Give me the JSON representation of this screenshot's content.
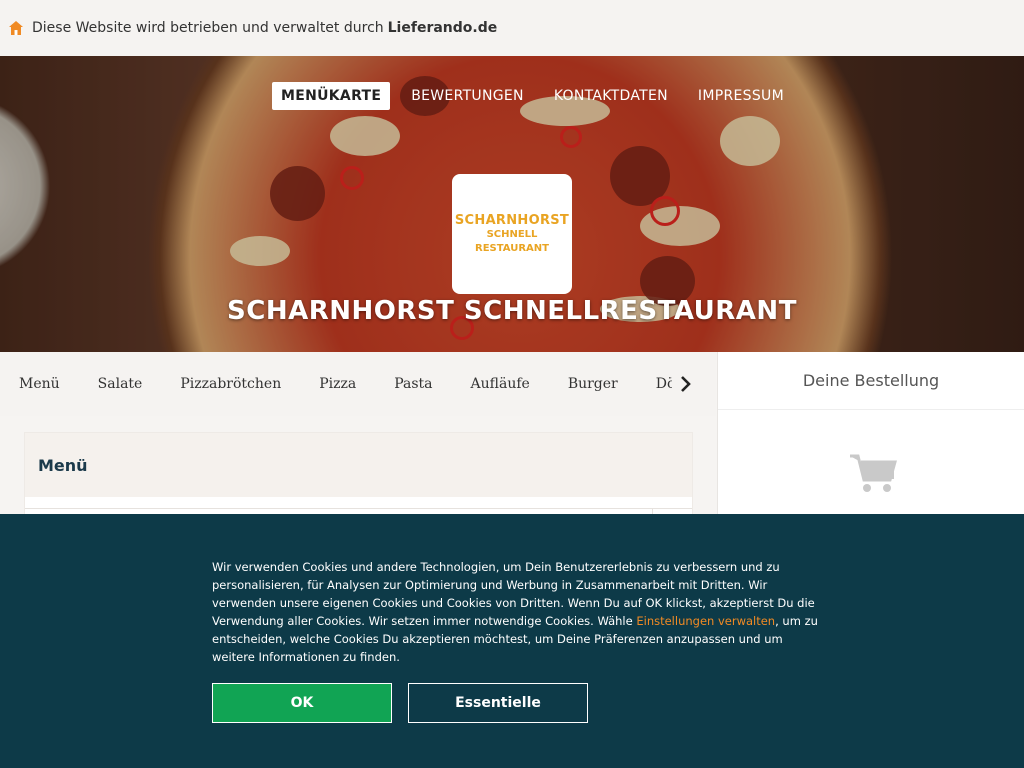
{
  "topbar": {
    "icon": "home-icon",
    "text": "Diese Website wird betrieben und verwaltet durch",
    "brand": "Lieferando.de"
  },
  "nav": {
    "items": [
      "MENÜKARTE",
      "BEWERTUNGEN",
      "KONTAKTDATEN",
      "IMPRESSUM"
    ],
    "active": "MENÜKARTE"
  },
  "logo": {
    "line1": "SCHARNHORST",
    "line2": "SCHNELL",
    "line3": "RESTAURANT",
    "color": "#e9a423"
  },
  "restaurant_name": "SCHARNHORST SCHNELLRESTAURANT",
  "categories": {
    "items": [
      "Menü",
      "Salate",
      "Pizzabrötchen",
      "Pizza",
      "Pasta",
      "Aufläufe",
      "Burger",
      "Dön"
    ],
    "next_icon": "chevron-right-icon"
  },
  "menu_section": {
    "title": "Menü"
  },
  "order": {
    "title": "Deine Bestellung",
    "icon": "cart-icon"
  },
  "cookie": {
    "text_before_link": "Wir verwenden Cookies und andere Technologien, um Dein Benutzererlebnis zu verbessern und zu personalisieren, für Analysen zur Optimierung und Werbung in Zusammenarbeit mit Dritten. Wir verwenden unsere eigenen Cookies und Cookies von Dritten. Wenn Du auf OK klickst, akzeptierst Du die Verwendung aller Cookies. Wir setzen immer notwendige Cookies. Wähle ",
    "link": "Einstellungen verwalten",
    "text_after_link": ", um zu entscheiden, welche Cookies Du akzeptieren möchtest, um Deine Präferenzen anzupassen und um weitere Informationen zu finden.",
    "ok_label": "OK",
    "essential_label": "Essentielle",
    "background": "#0d3a48",
    "ok_color": "#11a454",
    "link_color": "#f08a24"
  }
}
